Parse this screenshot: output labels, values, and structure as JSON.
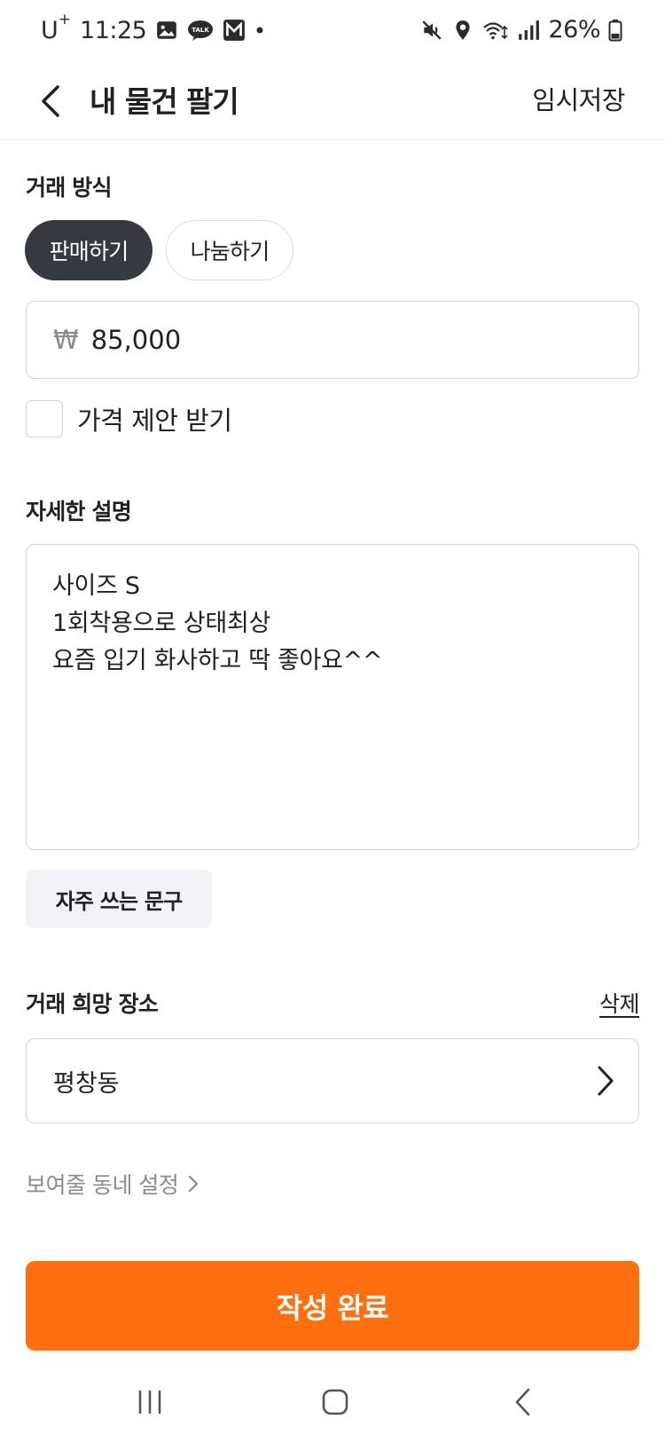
{
  "status_bar": {
    "carrier": "U",
    "carrier_sup": "+",
    "time": "11:25",
    "battery": "26%",
    "icons_left": [
      "gallery-icon",
      "kakaotalk-icon",
      "gmail-icon",
      "dot-icon"
    ],
    "icons_right": [
      "mute-icon",
      "location-icon",
      "wifi-icon",
      "signal-icon",
      "battery-icon"
    ]
  },
  "header": {
    "title": "내 물건 팔기",
    "save_draft": "임시저장"
  },
  "trade_method": {
    "title": "거래 방식",
    "options": [
      "판매하기",
      "나눔하기"
    ],
    "selected": "판매하기"
  },
  "price": {
    "currency_symbol": "₩",
    "value": "85,000"
  },
  "price_offer": {
    "label": "가격 제안 받기",
    "checked": false
  },
  "description": {
    "title": "자세한 설명",
    "lines": [
      "사이즈 S",
      "1회착용으로 상태최상",
      "요즘 입기 화사하고 딱 좋아요^^"
    ]
  },
  "phrase_button": "자주 쓰는 문구",
  "location": {
    "title": "거래 희망 장소",
    "delete": "삭제",
    "value": "평창동"
  },
  "neighborhood_setting": "보여줄 동네 설정",
  "submit": "작성 완료",
  "colors": {
    "accent": "#ff6f0f",
    "selected_pill": "#343a40",
    "border": "#d1d3d8"
  }
}
